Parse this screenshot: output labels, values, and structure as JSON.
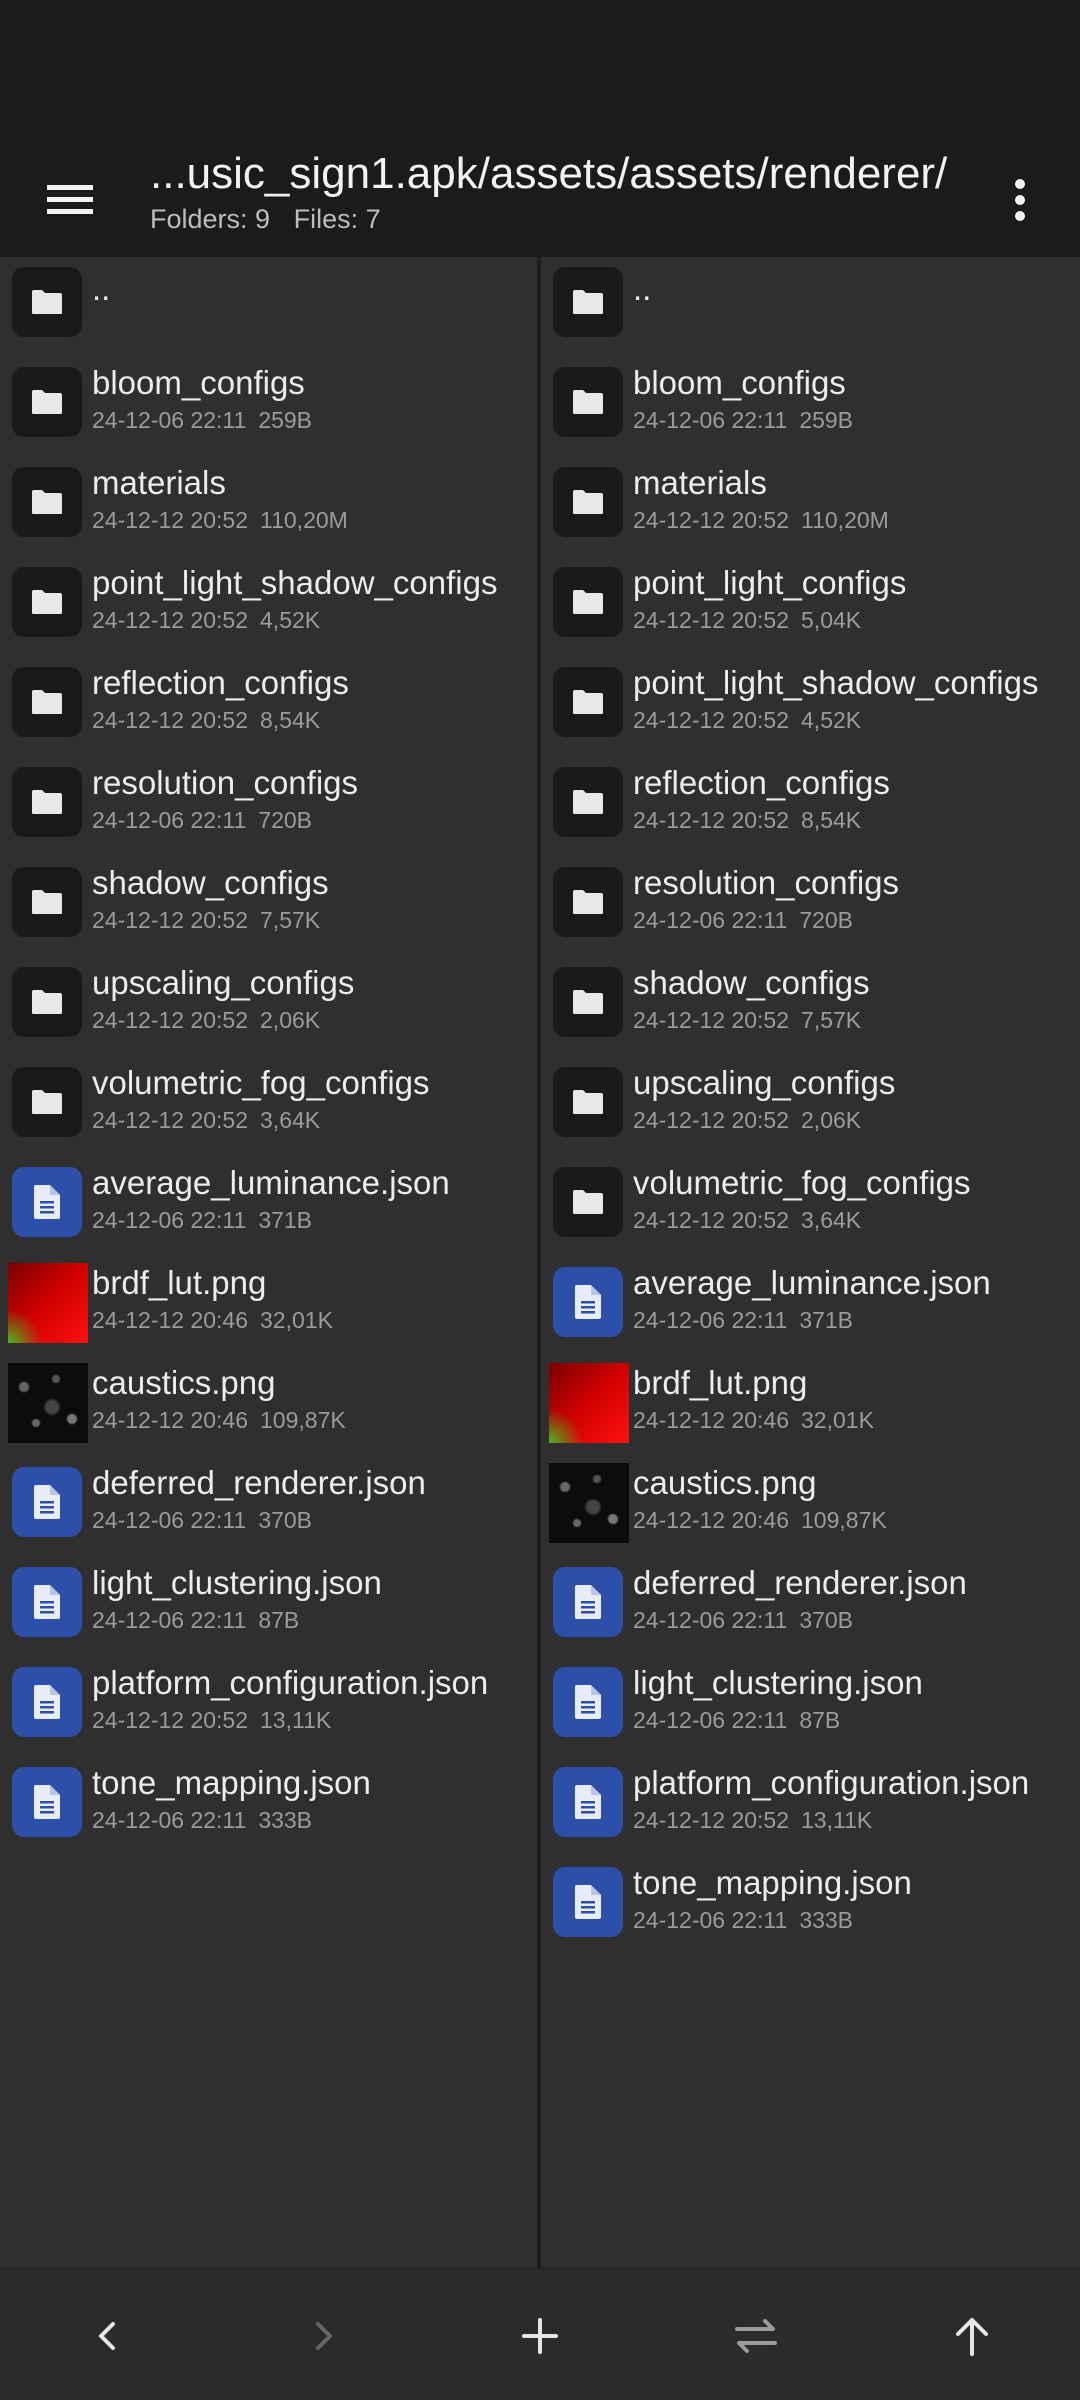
{
  "header": {
    "path": "...usic_sign1.apk/assets/assets/renderer/",
    "folders_text": "Folders: 9",
    "files_text": "Files: 7"
  },
  "left_pane": {
    "parent_label": "..",
    "items": [
      {
        "name": "bloom_configs",
        "date": "24-12-06 22:11",
        "size": "259B",
        "kind": "folder"
      },
      {
        "name": "materials",
        "date": "24-12-12 20:52",
        "size": "110,20M",
        "kind": "folder"
      },
      {
        "name": "point_light_shadow_configs",
        "date": "24-12-12 20:52",
        "size": "4,52K",
        "kind": "folder"
      },
      {
        "name": "reflection_configs",
        "date": "24-12-12 20:52",
        "size": "8,54K",
        "kind": "folder"
      },
      {
        "name": "resolution_configs",
        "date": "24-12-06 22:11",
        "size": "720B",
        "kind": "folder"
      },
      {
        "name": "shadow_configs",
        "date": "24-12-12 20:52",
        "size": "7,57K",
        "kind": "folder"
      },
      {
        "name": "upscaling_configs",
        "date": "24-12-12 20:52",
        "size": "2,06K",
        "kind": "folder"
      },
      {
        "name": "volumetric_fog_configs",
        "date": "24-12-12 20:52",
        "size": "3,64K",
        "kind": "folder"
      },
      {
        "name": "average_luminance.json",
        "date": "24-12-06 22:11",
        "size": "371B",
        "kind": "doc"
      },
      {
        "name": "brdf_lut.png",
        "date": "24-12-12 20:46",
        "size": "32,01K",
        "kind": "image-red"
      },
      {
        "name": "caustics.png",
        "date": "24-12-12 20:46",
        "size": "109,87K",
        "kind": "image-dark"
      },
      {
        "name": "deferred_renderer.json",
        "date": "24-12-06 22:11",
        "size": "370B",
        "kind": "doc"
      },
      {
        "name": "light_clustering.json",
        "date": "24-12-06 22:11",
        "size": "87B",
        "kind": "doc"
      },
      {
        "name": "platform_configuration.json",
        "date": "24-12-12 20:52",
        "size": "13,11K",
        "kind": "doc"
      },
      {
        "name": "tone_mapping.json",
        "date": "24-12-06 22:11",
        "size": "333B",
        "kind": "doc"
      }
    ]
  },
  "right_pane": {
    "parent_label": "..",
    "items": [
      {
        "name": "bloom_configs",
        "date": "24-12-06 22:11",
        "size": "259B",
        "kind": "folder"
      },
      {
        "name": "materials",
        "date": "24-12-12 20:52",
        "size": "110,20M",
        "kind": "folder"
      },
      {
        "name": "point_light_configs",
        "date": "24-12-12 20:52",
        "size": "5,04K",
        "kind": "folder"
      },
      {
        "name": "point_light_shadow_configs",
        "date": "24-12-12 20:52",
        "size": "4,52K",
        "kind": "folder"
      },
      {
        "name": "reflection_configs",
        "date": "24-12-12 20:52",
        "size": "8,54K",
        "kind": "folder"
      },
      {
        "name": "resolution_configs",
        "date": "24-12-06 22:11",
        "size": "720B",
        "kind": "folder"
      },
      {
        "name": "shadow_configs",
        "date": "24-12-12 20:52",
        "size": "7,57K",
        "kind": "folder"
      },
      {
        "name": "upscaling_configs",
        "date": "24-12-12 20:52",
        "size": "2,06K",
        "kind": "folder"
      },
      {
        "name": "volumetric_fog_configs",
        "date": "24-12-12 20:52",
        "size": "3,64K",
        "kind": "folder"
      },
      {
        "name": "average_luminance.json",
        "date": "24-12-06 22:11",
        "size": "371B",
        "kind": "doc"
      },
      {
        "name": "brdf_lut.png",
        "date": "24-12-12 20:46",
        "size": "32,01K",
        "kind": "image-red"
      },
      {
        "name": "caustics.png",
        "date": "24-12-12 20:46",
        "size": "109,87K",
        "kind": "image-dark"
      },
      {
        "name": "deferred_renderer.json",
        "date": "24-12-06 22:11",
        "size": "370B",
        "kind": "doc"
      },
      {
        "name": "light_clustering.json",
        "date": "24-12-06 22:11",
        "size": "87B",
        "kind": "doc"
      },
      {
        "name": "platform_configuration.json",
        "date": "24-12-12 20:52",
        "size": "13,11K",
        "kind": "doc"
      },
      {
        "name": "tone_mapping.json",
        "date": "24-12-06 22:11",
        "size": "333B",
        "kind": "doc"
      }
    ]
  },
  "bottom_nav": [
    {
      "icon": "chevron-left-icon",
      "enabled": true
    },
    {
      "icon": "chevron-right-icon",
      "enabled": false
    },
    {
      "icon": "plus-icon",
      "enabled": true
    },
    {
      "icon": "swap-icon",
      "enabled": true
    },
    {
      "icon": "arrow-up-icon",
      "enabled": true
    }
  ],
  "colors": {
    "background": "#2f2f2f",
    "toolbar": "#1b1b1b",
    "doc_icon": "#2e4fa8",
    "folder_icon_bg": "#1a1a1a"
  }
}
